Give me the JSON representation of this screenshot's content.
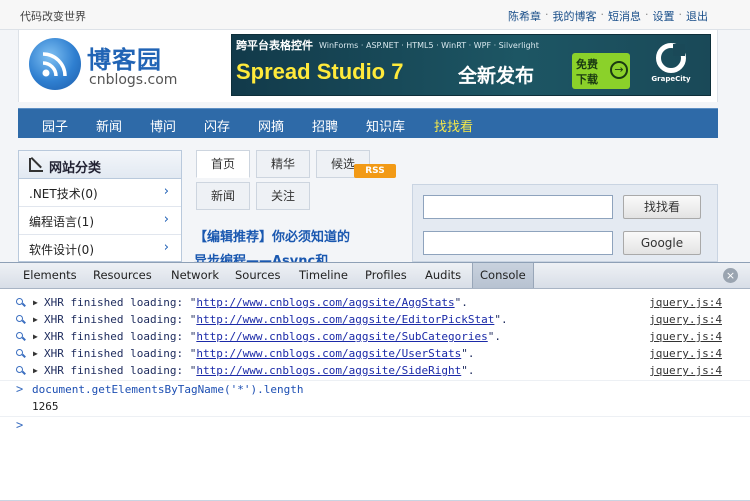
{
  "site": {
    "slogan": "代码改变世界",
    "toplinks": [
      "陈希章",
      "我的博客",
      "短消息",
      "设置",
      "退出"
    ],
    "toplink_sep": "·",
    "logo": {
      "title": "博客园",
      "subtitle": "cnblogs.com"
    },
    "banner": {
      "top_title": "跨平台表格控件",
      "top_tags": "WinForms · ASP.NET · HTML5 · WinRT · WPF · Silverlight",
      "product": "Spread Studio 7",
      "tagline": "全新发布",
      "free_line1": "免费",
      "free_line2": "下载",
      "arrow": "→",
      "brand": "GrapeCity"
    },
    "nav": [
      "园子",
      "新闻",
      "博问",
      "闪存",
      "网摘",
      "招聘",
      "知识库",
      "找找看"
    ],
    "sidebar": {
      "title": "网站分类",
      "items": [
        ".NET技术(0)",
        "编程语言(1)",
        "软件设计(0)"
      ],
      "chevron": "›"
    },
    "tabs": {
      "row1": [
        "首页",
        "精华",
        "候选"
      ],
      "row2": [
        "新闻",
        "关注"
      ],
      "rss": "RSS"
    },
    "headline": "【编辑推荐】你必须知道的",
    "headline2": "异步编程——Async和",
    "search": {
      "button1": "找找看",
      "button2": "Google"
    }
  },
  "devtools": {
    "tabs": [
      "Elements",
      "Resources",
      "Network",
      "Sources",
      "Timeline",
      "Profiles",
      "Audits",
      "Console"
    ],
    "active_tab": "Console",
    "close_icon": "×",
    "logs": [
      {
        "prefix": "XHR finished loading: \"",
        "url": "http://www.cnblogs.com/aggsite/AggStats",
        "suffix": "\".",
        "source": "jquery.js:4"
      },
      {
        "prefix": "XHR finished loading: \"",
        "url": "http://www.cnblogs.com/aggsite/EditorPickStat",
        "suffix": "\".",
        "source": "jquery.js:4"
      },
      {
        "prefix": "XHR finished loading: \"",
        "url": "http://www.cnblogs.com/aggsite/SubCategories",
        "suffix": "\".",
        "source": "jquery.js:4"
      },
      {
        "prefix": "XHR finished loading: \"",
        "url": "http://www.cnblogs.com/aggsite/UserStats",
        "suffix": "\".",
        "source": "jquery.js:4"
      },
      {
        "prefix": "XHR finished loading: \"",
        "url": "http://www.cnblogs.com/aggsite/SideRight",
        "suffix": "\".",
        "source": "jquery.js:4"
      }
    ],
    "command": "document.getElementsByTagName('*').length",
    "result": "1265",
    "prompt": ">",
    "result_prefix": "<",
    "triangle": "▶"
  }
}
